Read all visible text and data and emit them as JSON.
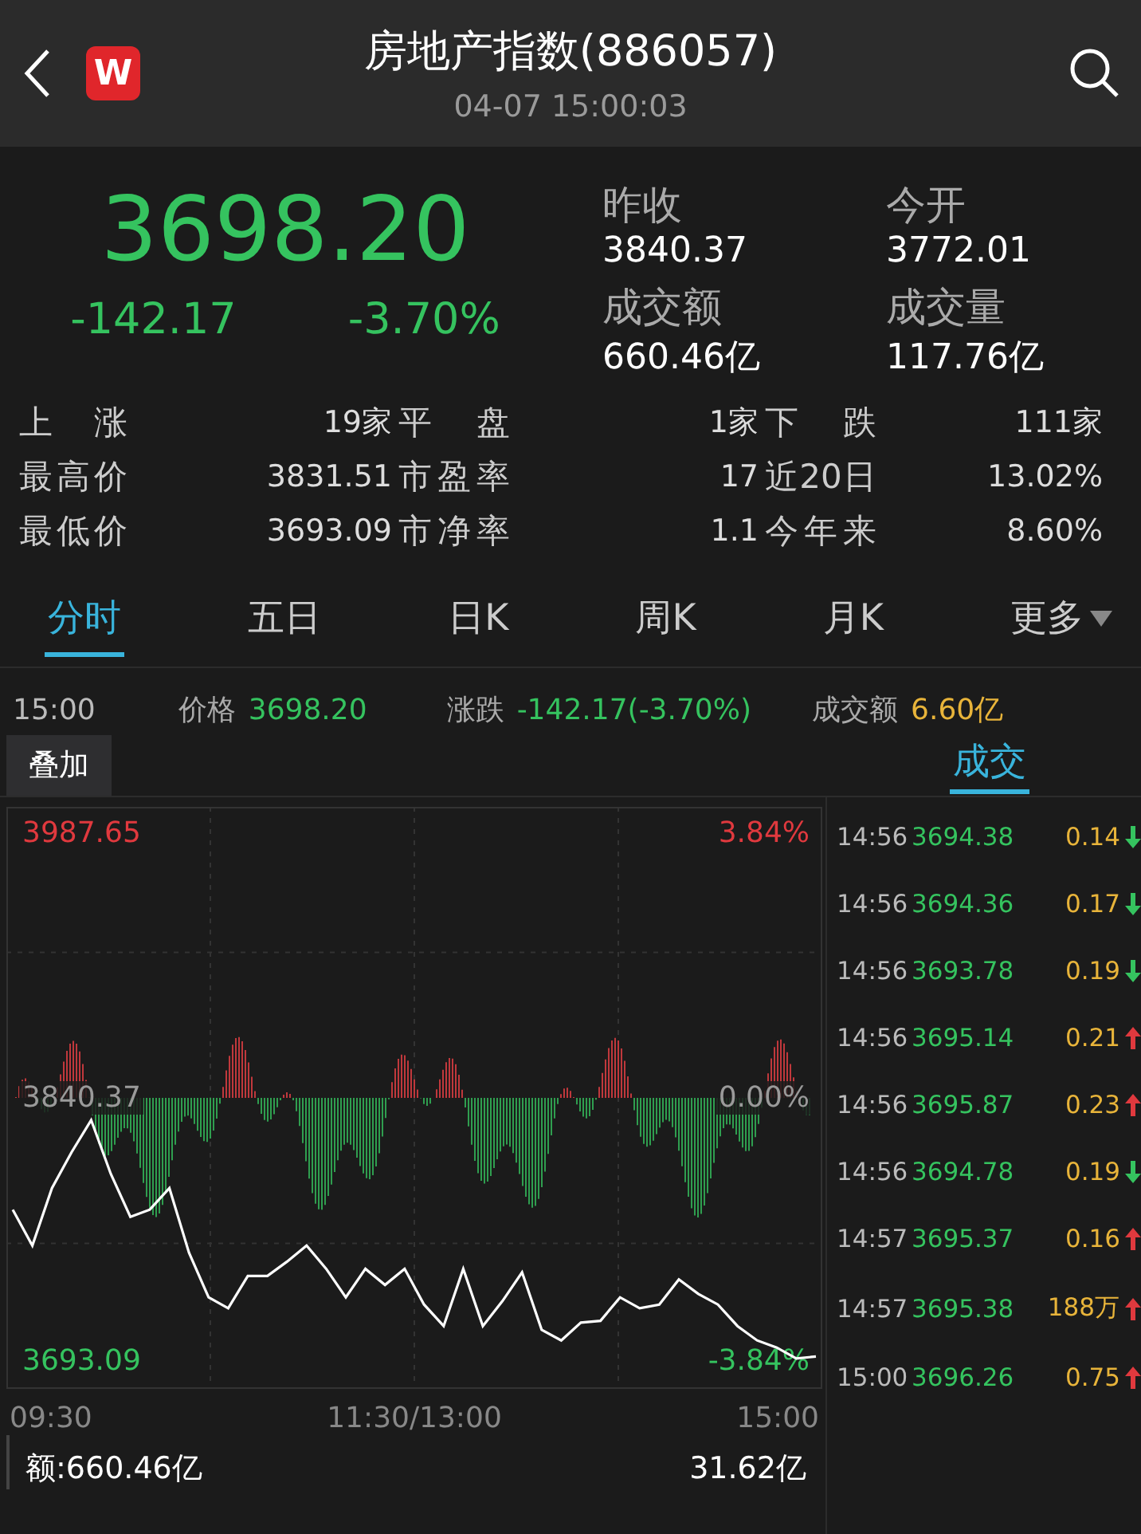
{
  "header": {
    "logo": "W",
    "title": "房地产指数(886057)",
    "time": "04-07 15:00:03"
  },
  "quote": {
    "price": "3698.20",
    "change": "-142.17",
    "percent": "-3.70%",
    "up": false
  },
  "stats": [
    {
      "label": "昨收",
      "value": "3840.37"
    },
    {
      "label": "今开",
      "value": "3772.01"
    },
    {
      "label": "成交额",
      "value": "660.46亿"
    },
    {
      "label": "成交量",
      "value": "117.76亿"
    }
  ],
  "summary_rows": [
    [
      {
        "label": "上 涨",
        "value": "19家"
      },
      {
        "label": "平 盘",
        "value": "1家"
      },
      {
        "label": "下 跌",
        "value": "111家"
      }
    ],
    [
      {
        "label": "最高价",
        "value": "3831.51"
      },
      {
        "label": "市盈率",
        "value": "17"
      },
      {
        "label": "近20日",
        "value": "13.02%"
      }
    ],
    [
      {
        "label": "最低价",
        "value": "3693.09"
      },
      {
        "label": "市净率",
        "value": "1.1"
      },
      {
        "label": "今年来",
        "value": "8.60%"
      }
    ]
  ],
  "tabs": [
    {
      "label": "分时",
      "selected": true,
      "kind": "tab"
    },
    {
      "label": "五日",
      "selected": false,
      "kind": "tab"
    },
    {
      "label": "日K",
      "selected": false,
      "kind": "tab"
    },
    {
      "label": "周K",
      "selected": false,
      "kind": "tab"
    },
    {
      "label": "月K",
      "selected": false,
      "kind": "tab"
    },
    {
      "label": "更多",
      "selected": false,
      "kind": "dropdown"
    }
  ],
  "info_bar": {
    "time": "15:00",
    "price": "3698.20",
    "change_label": "涨跌",
    "change": "-142.17(-3.70%)",
    "amount_label": "成交额",
    "amount": "6.60亿"
  },
  "overlay_button": "叠加",
  "side_tab": {
    "label": "成交",
    "selected": true
  },
  "chart": {
    "percent_labels": [
      "3.84%",
      "0.00%",
      "-3.84%"
    ],
    "time_labels": [
      "09:30",
      "11:30/13:00",
      "15:00"
    ],
    "chart_data": {
      "type": "line",
      "categories": [
        null,
        null,
        null,
        null,
        null,
        null,
        null,
        null,
        null,
        null,
        null,
        null,
        null,
        null,
        null,
        null,
        null,
        null,
        null,
        null,
        null,
        null,
        null,
        null,
        null,
        null,
        null,
        null,
        null,
        null,
        null,
        null,
        null,
        null,
        null,
        null,
        null,
        null,
        null,
        null,
        null,
        null
      ],
      "ylim": [
        3677.96,
        4002.78
      ],
      "yticks": [
        {
          "value": 3987.65,
          "label": "3987.65"
        },
        {
          "value": 3840.37,
          "label": "3840.37"
        },
        {
          "value": 3693.09,
          "label": "3693.09"
        }
      ],
      "series": [
        {
          "name": "价格",
          "color": "#ffffff",
          "values": [
            3778,
            3758,
            3790,
            3810,
            3828,
            3798,
            3774,
            3778,
            3790,
            3754,
            3729,
            3723,
            3741,
            3741,
            3749,
            3758,
            3745,
            3729,
            3745,
            3736,
            3745,
            3725,
            3713,
            3745,
            3713,
            3727,
            3743,
            3711,
            3705,
            3715,
            3716,
            3729,
            3723,
            3725,
            3739,
            3731,
            3725,
            3713,
            3705,
            3701,
            3695,
            3696
          ]
        }
      ]
    }
  },
  "footer": {
    "amount": "额:660.46亿",
    "right": "31.62亿"
  },
  "trades": [
    {
      "time": "14:56",
      "price": "3694.38",
      "volume": "0.14",
      "up": false
    },
    {
      "time": "14:56",
      "price": "3694.36",
      "volume": "0.17",
      "up": false
    },
    {
      "time": "14:56",
      "price": "3693.78",
      "volume": "0.19",
      "up": false
    },
    {
      "time": "14:56",
      "price": "3695.14",
      "volume": "0.21",
      "up": true
    },
    {
      "time": "14:56",
      "price": "3695.87",
      "volume": "0.23",
      "up": true
    },
    {
      "time": "14:56",
      "price": "3694.78",
      "volume": "0.19",
      "up": false
    },
    {
      "time": "14:57",
      "price": "3695.37",
      "volume": "0.16",
      "up": true
    },
    {
      "time": "14:57",
      "price": "3695.38",
      "volume": "188万",
      "up": true
    },
    {
      "time": "15:00",
      "price": "3696.26",
      "volume": "0.75",
      "up": true
    }
  ]
}
